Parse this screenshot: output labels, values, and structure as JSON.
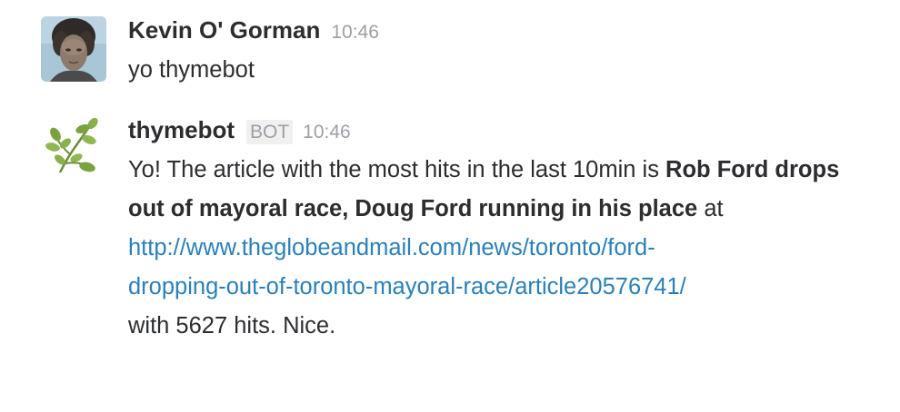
{
  "messages": [
    {
      "author": "Kevin O' Gorman",
      "time": "10:46",
      "avatar_icon": "user-photo-avatar",
      "text": "yo thymebot"
    },
    {
      "author": "thymebot",
      "badge": "BOT",
      "time": "10:46",
      "avatar_icon": "herb-sprig-icon",
      "text_intro": "Yo! The article with the most hits in the last 10min is ",
      "article_title": "Rob Ford drops out of mayoral race, Doug Ford running in his place",
      "text_at": " at",
      "link_line1": "http://www.theglobeandmail.com/news/toronto/ford-",
      "link_line2": "dropping-out-of-toronto-mayoral-race/article20576741/",
      "text_outro": "with 5627 hits. Nice."
    }
  ],
  "colors": {
    "link": "#2a80b9",
    "timestamp": "#9e9ea6",
    "text": "#2c2d30",
    "badge_bg": "#f0f0f0"
  }
}
